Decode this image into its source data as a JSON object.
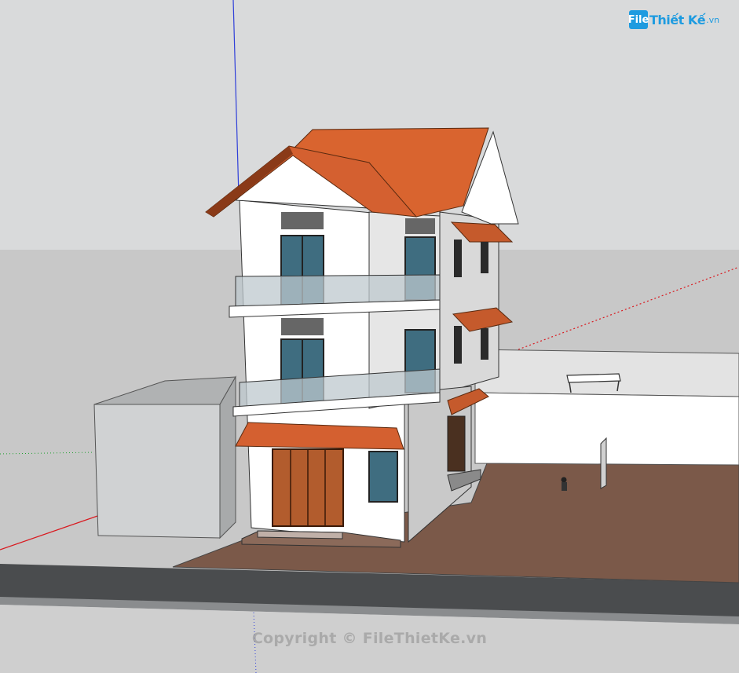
{
  "app": {
    "view": "SketchUp 3D model viewport"
  },
  "logo": {
    "mark": "File",
    "text": "Thiết Kế",
    "suffix": ".vn"
  },
  "watermark": {
    "text": "Copyright © FileThietKe.vn"
  },
  "colors": {
    "sky": "#d9dadb",
    "ground": "#c8c8c8",
    "road": "#4a4c4e",
    "plot": "#7a5a4a",
    "wall": "#ffffff",
    "roof": "#d9642f",
    "glass": "#3f6d80",
    "door": "#b25c2d",
    "axis_red": "#d9191f",
    "axis_green": "#1fa02f",
    "axis_blue": "#2f3fd9",
    "brand": "#1e9be0"
  },
  "icons": {
    "logo": "filethietke-logo-icon",
    "person": "person-figure-icon",
    "bench": "bench-icon"
  }
}
